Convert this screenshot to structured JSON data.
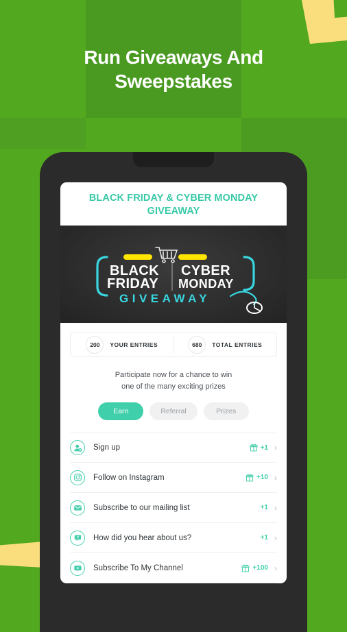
{
  "hero": {
    "line1": "Run Giveaways And",
    "line2": "Sweepstakes"
  },
  "colors": {
    "green_light": "#52a81e",
    "green_dark": "#4a9a22",
    "yellow": "#fade7e",
    "teal": "#3fcfab",
    "title_teal": "#38c9a6",
    "phone_frame": "#2b2b2b",
    "banner_dark": "#2e2e2e",
    "cyan_neon": "#39d6e0",
    "banner_yellow": "#ffe500"
  },
  "phone": {
    "screen_title": "BLACK FRIDAY & CYBER MONDAY GIVEAWAY",
    "banner": {
      "black_friday_line1": "BLACK",
      "black_friday_line2": "FRIDAY",
      "cyber_line1": "CYBER",
      "cyber_line2": "MONDAY",
      "giveaway": "GIVEAWAY",
      "cart_icon": "shopping-cart-icon",
      "mouse_icon": "computer-mouse-icon"
    },
    "entries": [
      {
        "value": "200",
        "label": "YOUR ENTRIES"
      },
      {
        "value": "680",
        "label": "TOTAL ENTRIES"
      }
    ],
    "blurb_line1": "Participate now for a chance to win",
    "blurb_line2": "one of the many exciting prizes",
    "tabs": [
      {
        "label": "Earn",
        "active": true
      },
      {
        "label": "Referral",
        "active": false
      },
      {
        "label": "Prizes",
        "active": false
      }
    ],
    "tasks": [
      {
        "label": "Sign up",
        "points": "+1",
        "gift": true,
        "icon": "person-add-icon"
      },
      {
        "label": "Follow on Instagram",
        "points": "+10",
        "gift": true,
        "icon": "instagram-icon"
      },
      {
        "label": "Subscribe to our mailing list",
        "points": "+1",
        "gift": false,
        "icon": "envelope-icon"
      },
      {
        "label": "How did you hear about us?",
        "points": "+1",
        "gift": false,
        "icon": "question-bubble-icon"
      },
      {
        "label": "Subscribe To My Channel",
        "points": "+100",
        "gift": true,
        "icon": "youtube-play-icon"
      }
    ],
    "chevron": "›"
  }
}
